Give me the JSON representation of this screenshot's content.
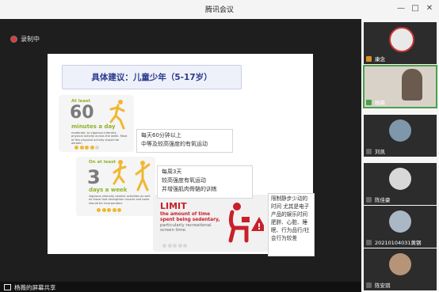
{
  "window": {
    "title": "腾讯会议",
    "controls": [
      "—",
      "□",
      "✕"
    ],
    "accent_green": "#4aa14d"
  },
  "stage": {
    "recording_label": "录制中",
    "screen_share_label": "杨薇的屏幕共享"
  },
  "slide": {
    "heading": "具体建议：儿童少年（5-17岁）",
    "card1": {
      "at_least": "At least",
      "number": "60",
      "unit": "minutes a day",
      "text": "moderate- to vigorous-intensity physical activity across the week. Most of this physical activity should be aerobic."
    },
    "card2": {
      "on_at_least": "On at least",
      "number": "3",
      "unit": "days a week",
      "text": "vigorous-intensity aerobic activities as well as those that strengthen muscle and bone should be incorporated."
    },
    "card3": {
      "title": "LIMIT",
      "subtitle": "the amount of time spent being sedentary,",
      "text": "particularly recreational screen time."
    },
    "note1": [
      "每天60分钟以上",
      "中等及较高强度的有氧运动"
    ],
    "note2": [
      "每周3天",
      "较高强度有氧运动",
      "并增强肌肉骨骼的训练"
    ],
    "note3": "限制静步少动的时间 尤其是电子产品的娱乐时间 肥胖、心脏、睡眠、行为品行/社会行为较差"
  },
  "participants": [
    {
      "name": "康念",
      "mic": "off"
    },
    {
      "name": "杨薇",
      "mic": "on",
      "active": true
    },
    {
      "name": "刘凯",
      "mic": "none"
    },
    {
      "name": "陈佳豪",
      "mic": "none"
    },
    {
      "name": "20210104031黄钢",
      "mic": "none"
    },
    {
      "name": "陈安琪",
      "mic": "none"
    }
  ]
}
